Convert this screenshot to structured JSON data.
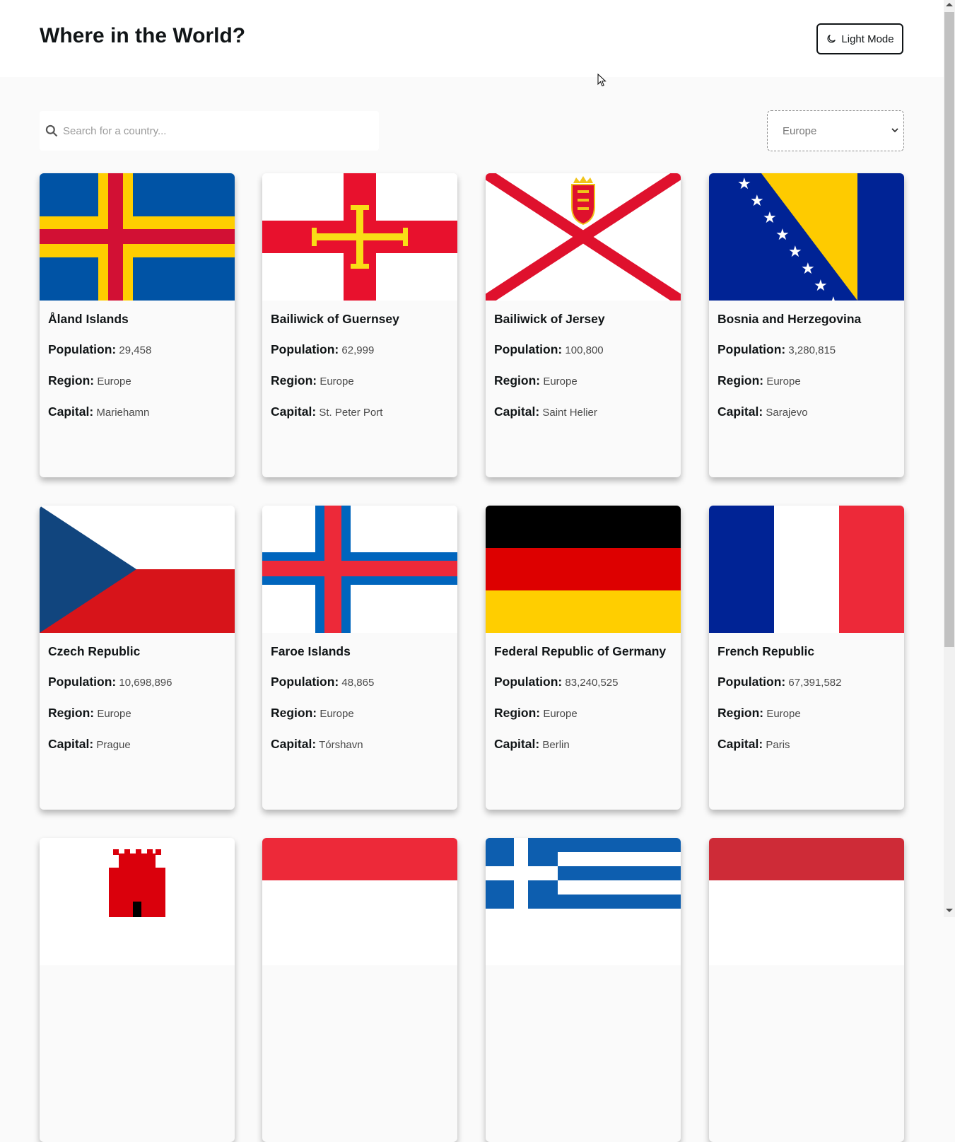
{
  "header": {
    "title": "Where in the World?",
    "mode_label": "Light Mode"
  },
  "search": {
    "placeholder": "Search for a country..."
  },
  "filter": {
    "selected": "Europe"
  },
  "labels": {
    "population": "Population:",
    "region": "Region:",
    "capital": "Capital:"
  },
  "countries": [
    {
      "name": "Åland Islands",
      "population": "29,458",
      "region": "Europe",
      "capital": "Mariehamn"
    },
    {
      "name": "Bailiwick of Guernsey",
      "population": "62,999",
      "region": "Europe",
      "capital": "St. Peter Port"
    },
    {
      "name": "Bailiwick of Jersey",
      "population": "100,800",
      "region": "Europe",
      "capital": "Saint Helier"
    },
    {
      "name": "Bosnia and Herzegovina",
      "population": "3,280,815",
      "region": "Europe",
      "capital": "Sarajevo"
    },
    {
      "name": "Czech Republic",
      "population": "10,698,896",
      "region": "Europe",
      "capital": "Prague"
    },
    {
      "name": "Faroe Islands",
      "population": "48,865",
      "region": "Europe",
      "capital": "Tórshavn"
    },
    {
      "name": "Federal Republic of Germany",
      "population": "83,240,525",
      "region": "Europe",
      "capital": "Berlin"
    },
    {
      "name": "French Republic",
      "population": "67,391,582",
      "region": "Europe",
      "capital": "Paris"
    }
  ],
  "colors": {
    "background": "#fafafa",
    "card": "#fafafa",
    "text": "#111517",
    "header": "#ffffff"
  }
}
